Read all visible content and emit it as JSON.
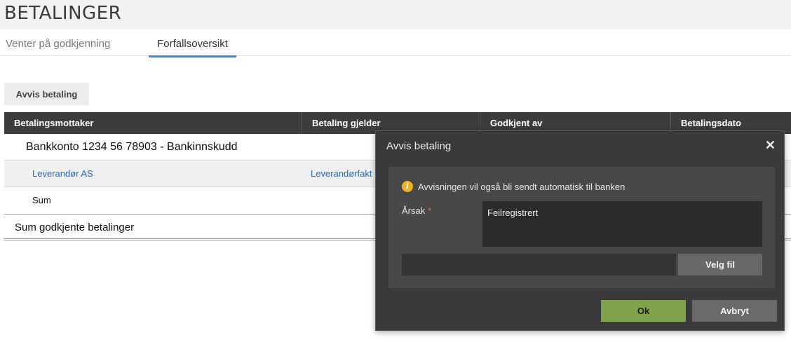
{
  "page": {
    "title": "BETALINGER"
  },
  "tabs": [
    {
      "label": "Venter på godkjenning",
      "active": false
    },
    {
      "label": "Forfallsoversikt",
      "active": true
    }
  ],
  "toolbar": {
    "reject_label": "Avvis betaling"
  },
  "table": {
    "columns": [
      "Betalingsmottaker",
      "Betaling gjelder",
      "Godkjent av",
      "Betalingsdato"
    ],
    "group_title": "Bankkonto 1234 56 78903 - Bankinnskudd",
    "item": {
      "recipient": "Leverandør AS",
      "concerns": "Leverandørfakt"
    },
    "sum_label": "Sum",
    "total_label": "Sum godkjente betalinger"
  },
  "dialog": {
    "title": "Avvis betaling",
    "info_text": "Avvisningen vil også bli sendt automatisk til banken",
    "reason_label": "Årsak",
    "reason_required_marker": "*",
    "reason_value": "Feilregistrert",
    "file_button_label": "Velg fil",
    "ok_label": "Ok",
    "cancel_label": "Avbryt"
  },
  "colors": {
    "tab_active_underline": "#3b86d6",
    "link": "#2a65c4",
    "ok_button": "#7ea34a",
    "info_icon": "#f0b21c",
    "required_marker": "#e6752b"
  },
  "icons": {
    "info": "info-circle-icon",
    "close": "close-icon"
  }
}
